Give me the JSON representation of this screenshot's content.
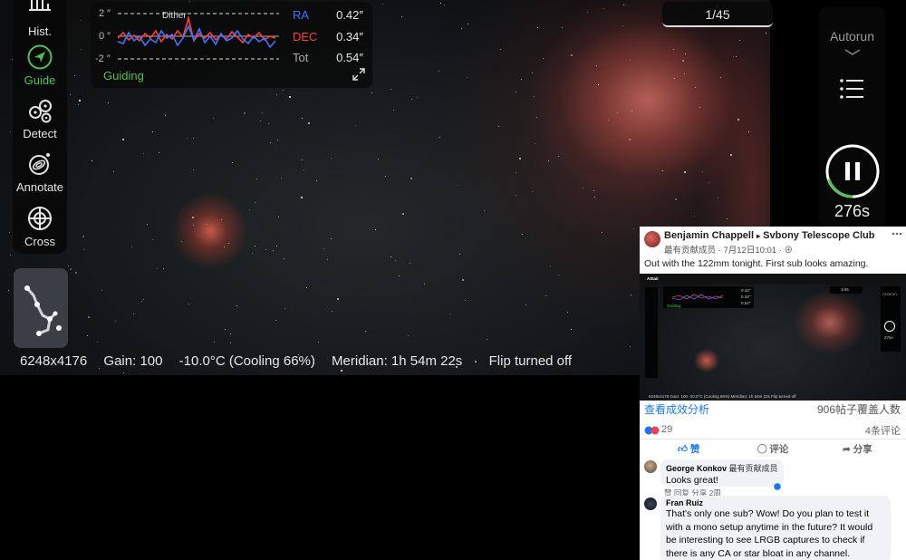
{
  "toolbar": {
    "hist_label": "Hist.",
    "guide_label": "Guide",
    "detect_label": "Detect",
    "annotate_label": "Annotate",
    "cross_label": "Cross"
  },
  "guiding": {
    "title": "Guiding",
    "dither_label": "Dither",
    "y_ticks": [
      "2 ″",
      "0 ″",
      "-2 ″"
    ],
    "stats": [
      {
        "name": "RA",
        "value": "0.42″",
        "color": "#3f74ff"
      },
      {
        "name": "DEC",
        "value": "0.34″",
        "color": "#ff3b3b"
      },
      {
        "name": "Tot",
        "value": "0.54″",
        "color": "#aaaaaa"
      }
    ]
  },
  "counter": "1/45",
  "autorun": {
    "label": "Autorun",
    "countdown": "276s"
  },
  "status": {
    "resolution": "6248x4176",
    "gain": "Gain: 100",
    "temperature": "-10.0°C (Cooling 66%)",
    "meridian": "Meridian: 1h 54m 22s",
    "separator": "·",
    "flip": "Flip turned off"
  },
  "facebook": {
    "author": "Benjamin Chappell",
    "arrow": "▸",
    "group": "Svbony Telescope Club",
    "badge": "最有贡献成员",
    "date": "7月12日10:01",
    "post_text": "Out with the 122mm tonight. First sub looks amazing.",
    "insights": "查看成效分析",
    "reach": "906帖子覆盖人数",
    "reactions": "29",
    "comments_count": "4条评论",
    "like_label": "赞",
    "comment_label": "评论",
    "share_label": "分享",
    "comments": [
      {
        "author": "George Konkov",
        "badge": "最有贡献成员",
        "text": "Looks great!",
        "meta": "赞  回复  分享  2周"
      },
      {
        "author": "Fran Ruiz",
        "text": "That's only one sub? Wow! Do you plan to test it with a mono setup anytime in the future? It would be interesting to see LRGB captures to check if there is any CA or star bloat in any channel. Thanks!"
      }
    ],
    "shot": {
      "asiair": "ASIair",
      "counter": "1/45",
      "autorun": "Autorun",
      "countdown": "276s",
      "ra": "0.42″",
      "dec": "0.34″",
      "tot": "0.54″",
      "status_line": "6248x4176   Gain: 100   -10.0°C (Cooling 66%)   Meridian: 1h 54m 22s   Flip turned off",
      "guiding": "Guiding"
    }
  }
}
